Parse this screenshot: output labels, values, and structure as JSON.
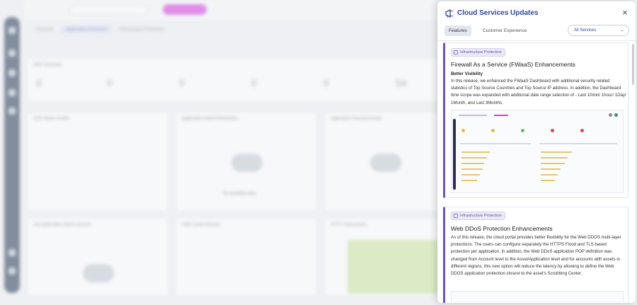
{
  "panel": {
    "title": "Cloud Services Updates",
    "close_label": "×",
    "tabs": [
      {
        "label": "Features",
        "active": true
      },
      {
        "label": "Customer Experience",
        "active": false
      }
    ],
    "filter": {
      "value": "All Services",
      "chevron": "⌄"
    }
  },
  "updates": [
    {
      "tag": "Infrastructure Protection",
      "title": "Firewall As a Service (FWaaS) Enhancements",
      "subtitle": "Better Visibility",
      "body": "In this release, we enhanced the FWaaS Dashboard with additional security related statistics of Top Source Countries and Top Source IP address. In addition, the Dashboard time scope was expanded with additional date range selection of - Last 10min/ 1hour/ 1Day/ 1Month, and Last 3Months."
    },
    {
      "tag": "Infrastructure Protection",
      "title": "Web DDoS Protection Enhancements",
      "body": "As of this release, the cloud portal provides better flexibility for the Web DDOS multi-layer protections. The users can configure separately the HTTPS Flood and TLS based protection per application. In addition, the Web DDoS application POP definition was changed from Account level to the Asset/Application level and for accounts with assets in different regions, this new option will reduce the latency by allowing to define the Web DDOS application protection closest to the asset's Scrubbing Center."
    }
  ],
  "background": {
    "tabs": [
      "Overview",
      "Application Protection",
      "Infrastructure Protection"
    ],
    "cards": [
      "WAF Summary",
      "CDN Status Codes",
      "Application Attack Distribution",
      "Application Security Events",
      "Top Application Attack Sources",
      "CDN Cache Results",
      "HTTP Transactions"
    ],
    "stats": [
      "0",
      "0",
      "0",
      "0",
      "0",
      "54"
    ],
    "no_data": "No available data",
    "accent_colors": {
      "title": "#2d47a8",
      "card_border": "#6d52c4",
      "sidebar": "#2c3e57",
      "pill": "#d63fe0"
    }
  }
}
